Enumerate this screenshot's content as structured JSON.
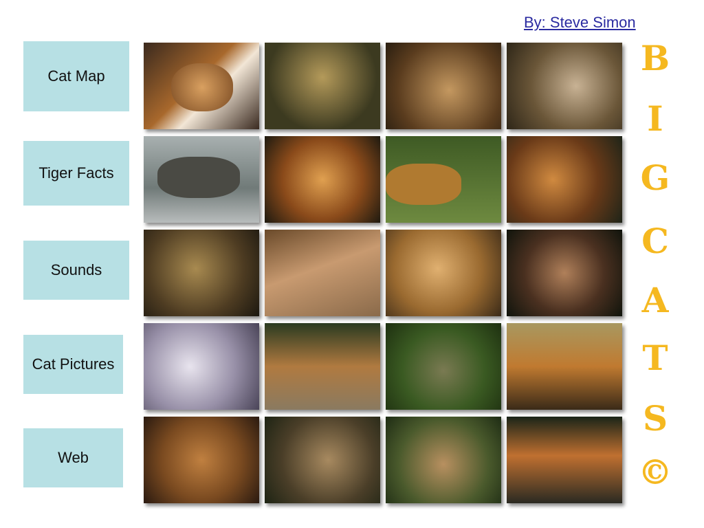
{
  "header": {
    "author_link": "By: Steve Simon"
  },
  "nav": {
    "cat_map": "Cat Map",
    "tiger_facts": "Tiger Facts",
    "sounds": "Sounds",
    "cat_pictures": "Cat Pictures",
    "web": "Web"
  },
  "title_letters": [
    "B",
    "I",
    "G",
    "C",
    "A",
    "T",
    "S",
    "©"
  ],
  "colors": {
    "nav_bg": "#b7e0e4",
    "title_letters": "#f5b820",
    "link": "#2a2aa0"
  },
  "photos": [
    {
      "subject": "tiger"
    },
    {
      "subject": "ocelot"
    },
    {
      "subject": "jaguar"
    },
    {
      "subject": "lion"
    },
    {
      "subject": "clouded-leopard"
    },
    {
      "subject": "tiger"
    },
    {
      "subject": "leopard"
    },
    {
      "subject": "tiger"
    },
    {
      "subject": "leopard"
    },
    {
      "subject": "lion"
    },
    {
      "subject": "cheetah"
    },
    {
      "subject": "lynx"
    },
    {
      "subject": "white-tiger"
    },
    {
      "subject": "tiger"
    },
    {
      "subject": "wildcat"
    },
    {
      "subject": "tiger"
    },
    {
      "subject": "lion"
    },
    {
      "subject": "cougar"
    },
    {
      "subject": "lioness"
    },
    {
      "subject": "tiger"
    }
  ]
}
